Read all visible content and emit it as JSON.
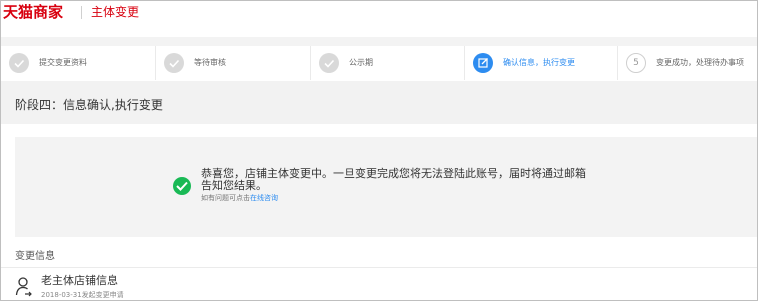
{
  "header": {
    "brand": "天猫商家",
    "title": "主体变更"
  },
  "steps": [
    {
      "label": "提交变更资料",
      "state": "done",
      "icon": "check-icon"
    },
    {
      "label": "等待审核",
      "state": "done",
      "icon": "check-icon"
    },
    {
      "label": "公示期",
      "state": "done",
      "icon": "check-icon"
    },
    {
      "label": "确认信息，执行变更",
      "state": "active",
      "icon": "edit-icon"
    },
    {
      "label": "变更成功，处理待办事项",
      "state": "pending",
      "number": "5"
    }
  ],
  "stage": {
    "title": "阶段四：信息确认,执行变更"
  },
  "notice": {
    "message": "恭喜您，店铺主体变更中。一旦变更完成您将无法登陆此账号，届时将通过邮箱告知您结果。",
    "help_prefix": "如有问题可点击",
    "help_link": "在线咨询",
    "icon": "success-check-icon",
    "color": "#19b955"
  },
  "section": {
    "title": "变更信息"
  },
  "owner": {
    "name": "老主体店铺信息",
    "date": "2018-03-31发起变更申请",
    "icon": "user-transfer-icon"
  },
  "colors": {
    "brand": "#d8000f",
    "accent": "#2d8cf0",
    "success": "#19b955"
  }
}
